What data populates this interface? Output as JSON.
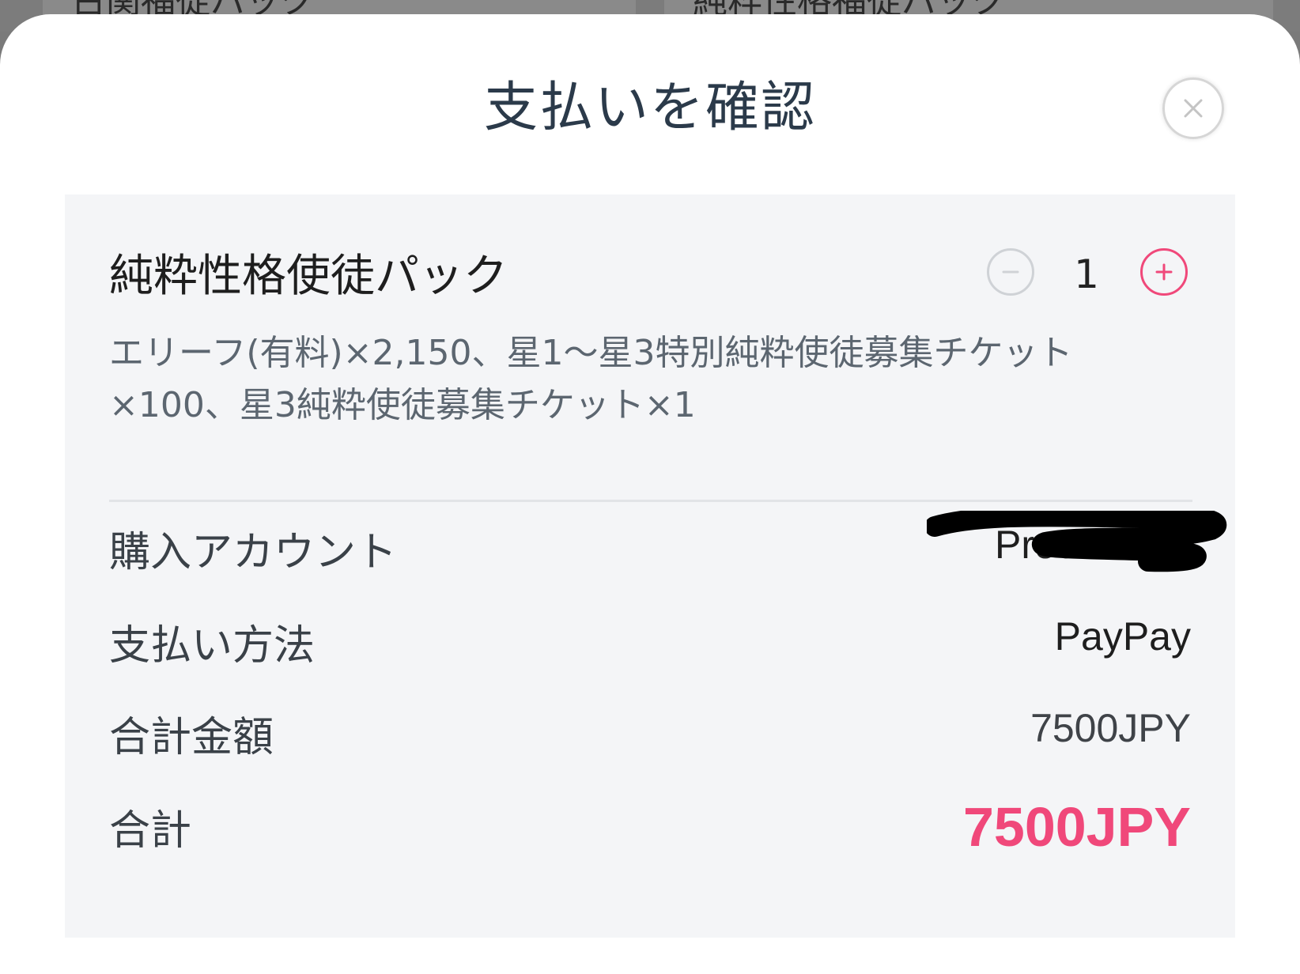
{
  "backdrop": {
    "left_card_text": "古関福徒パック",
    "right_card_text": "純粋性格福徒パック"
  },
  "dialog": {
    "title": "支払いを確認",
    "close_icon": "close-icon"
  },
  "product": {
    "name": "純粋性格使徒パック",
    "quantity": "1",
    "description": "エリーフ(有料)×2,150、星1〜星3特別純粋使徒募集チケット×100、星3純粋使徒募集チケット×1"
  },
  "details": {
    "account_label": "購入アカウント",
    "account_value": "ProdJP",
    "payment_label": "支払い方法",
    "payment_value": "PayPay",
    "subtotal_label": "合計金額",
    "subtotal_value": "7500JPY",
    "total_label": "合計",
    "total_value": "7500JPY"
  },
  "colors": {
    "accent": "#f0487a",
    "panel": "#f4f5f7",
    "title": "#2b3a4a"
  }
}
